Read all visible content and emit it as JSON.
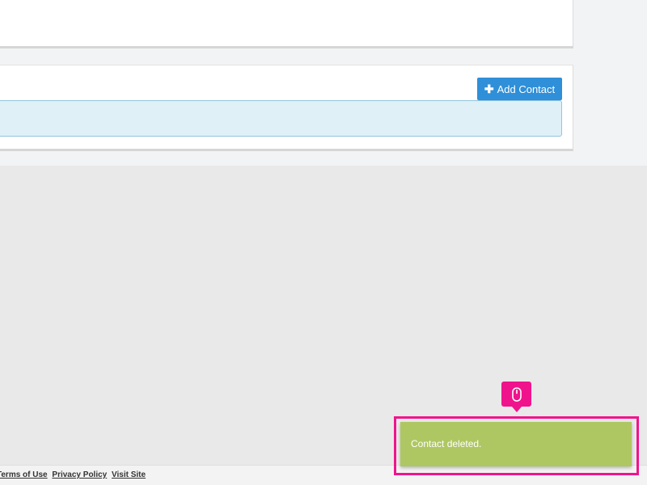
{
  "contacts_panel": {
    "add_contact_label": "Add Contact"
  },
  "footer": {
    "links": [
      "Terms of Use",
      "Privacy Policy",
      "Visit Site"
    ]
  },
  "toast": {
    "message": "Contact deleted."
  },
  "colors": {
    "accent_button": "#2f8fd8",
    "toast_background": "#afc762",
    "highlight": "#f0148c",
    "info_box": "#dff0f7"
  },
  "icons": {
    "add": "plus-icon",
    "cursor_marker": "mouse-icon"
  }
}
